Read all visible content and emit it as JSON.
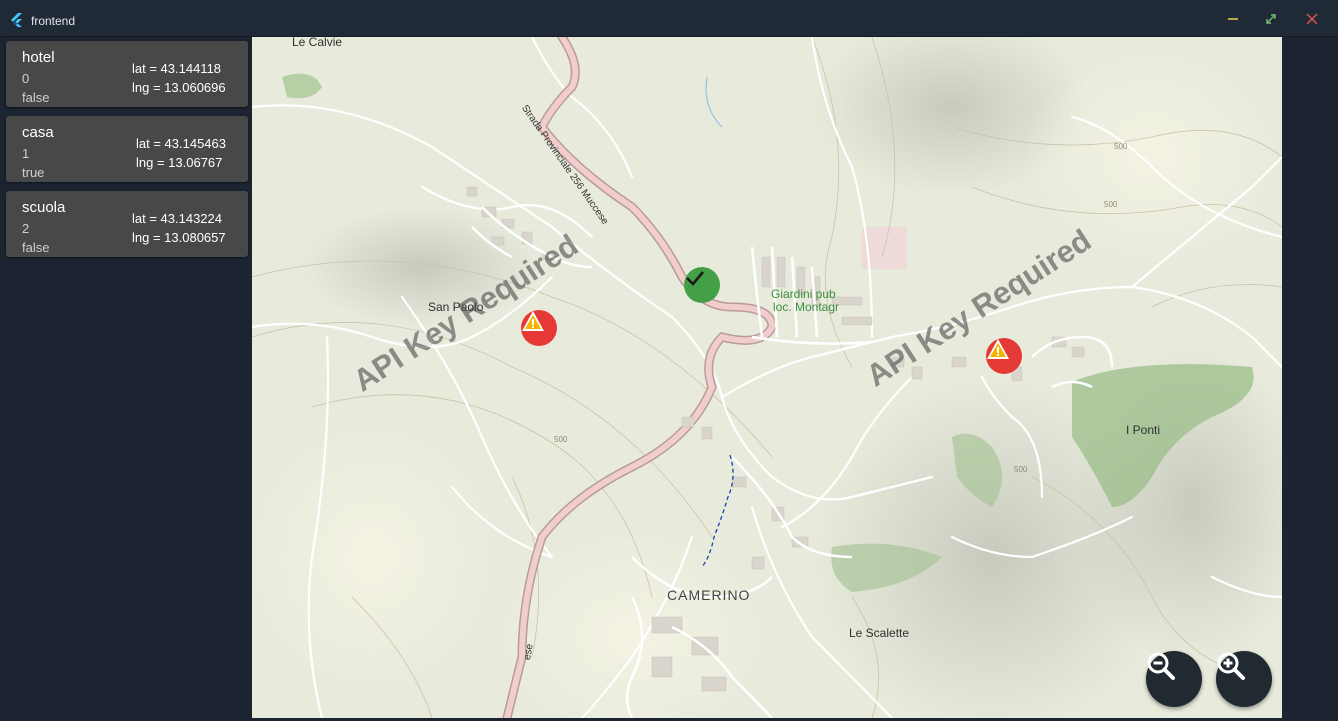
{
  "window": {
    "title": "frontend"
  },
  "locations": [
    {
      "name": "hotel",
      "index": "0",
      "flag": "false",
      "lat": "lat = 43.144118",
      "lng": "lng = 13.060696"
    },
    {
      "name": "casa",
      "index": "1",
      "flag": "true",
      "lat": "lat = 43.145463",
      "lng": "lng = 13.06767"
    },
    {
      "name": "scuola",
      "index": "2",
      "flag": "false",
      "lat": "lat = 43.143224",
      "lng": "lng = 13.080657"
    }
  ],
  "map": {
    "watermark": "API Key Required",
    "labels": {
      "le_calvie": "Le Calvie",
      "san_paolo": "San Paolo",
      "giardini_1": "Giardini pub",
      "giardini_2": "loc. Montagr",
      "i_ponti": "I Ponti",
      "camerino": "CAMERINO",
      "le_scalette": "Le Scalette",
      "road_main": "Strada Provinciale 256 Muccese",
      "road_bottom": "ese",
      "contour_500a": "500",
      "contour_500b": "500",
      "contour_500c": "500",
      "contour_500d": "500"
    },
    "markers": [
      {
        "name": "hotel",
        "status": "warning-icon"
      },
      {
        "name": "casa",
        "status": "check-icon"
      },
      {
        "name": "scuola",
        "status": "warning-icon"
      }
    ],
    "colors": {
      "warning": "#e53935",
      "ok": "#43a047",
      "base": "#e8ebdc"
    }
  },
  "controls": {
    "zoom_out": "zoom-out-icon",
    "zoom_in": "zoom-in-icon"
  }
}
